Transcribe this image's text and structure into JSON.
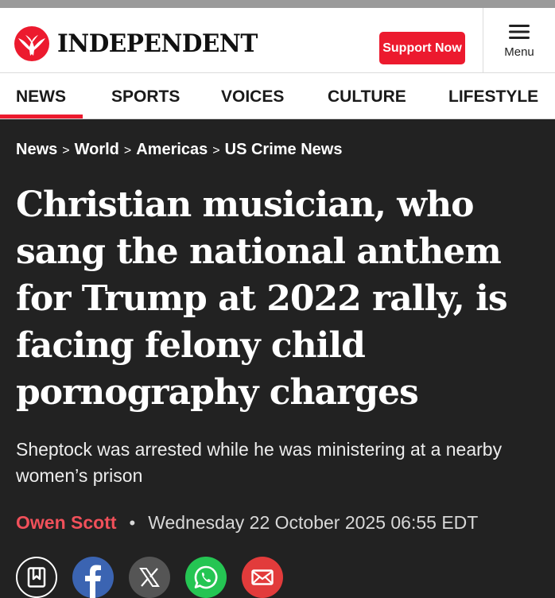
{
  "brand": {
    "name": "INDEPENDENT",
    "accent": "#ec1a2e"
  },
  "header": {
    "support_label": "Support Now",
    "menu_label": "Menu"
  },
  "nav": {
    "items": [
      {
        "label": "NEWS",
        "active": true
      },
      {
        "label": "SPORTS"
      },
      {
        "label": "VOICES"
      },
      {
        "label": "CULTURE"
      },
      {
        "label": "LIFESTYLE"
      }
    ]
  },
  "breadcrumb": {
    "sep": ">",
    "items": [
      "News",
      "World",
      "Americas",
      "US Crime News"
    ]
  },
  "article": {
    "headline": "Christian musician, who sang the national anthem for Trump at 2022 rally, is facing felony child pornography charges",
    "standfirst": "Sheptock was arrested while he was ministering at a nearby women’s prison",
    "author": "Owen Scott",
    "meta_sep": "•",
    "date": "Wednesday 22 October 2025 06:55 EDT"
  },
  "share": [
    {
      "icon": "bookmark-icon",
      "color": "#222222"
    },
    {
      "icon": "facebook-icon",
      "color": "#3b64b2"
    },
    {
      "icon": "x-icon",
      "color": "#555555"
    },
    {
      "icon": "whatsapp-icon",
      "color": "#25c553"
    },
    {
      "icon": "email-icon",
      "color": "#e23b3b"
    }
  ]
}
